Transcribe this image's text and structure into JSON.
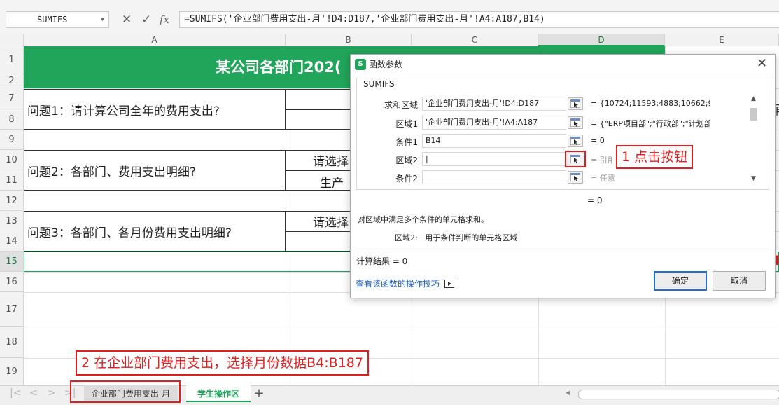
{
  "formula_bar": {
    "name_box": "SUMIFS",
    "cancel_glyph": "✕",
    "enter_glyph": "✓",
    "fx_label": "fx",
    "formula": "=SUMIFS('企业部门费用支出-月'!D4:D187,'企业部门费用支出-月'!A4:A187,B14)"
  },
  "columns": [
    "A",
    "B",
    "C",
    "D",
    "E"
  ],
  "rows": [
    "1",
    "2",
    "7",
    "8",
    "9",
    "10",
    "11",
    "12",
    "13",
    "14",
    "15",
    "16",
    "17",
    "18",
    "19"
  ],
  "sheet": {
    "title": "某公司各部门202(",
    "q1": "问题1：请计算公司全年的费用支出?",
    "q2": "问题2：各部门、费用支出明细?",
    "q2_b1": "请选择",
    "q2_b2": "生产",
    "q3": "问题3：各部门、各月份费用支出明细?",
    "q3_b1": "请选择",
    "edge_e7": "辅",
    "edge_e15": "4"
  },
  "tabs": {
    "sheet1": "企业部门费用支出-月",
    "sheet2": "学生操作区",
    "add": "+"
  },
  "annotations": {
    "step1": "1 点击按钮",
    "step2": "2 在企业部门费用支出，选择月份数据B4:B187"
  },
  "dialog": {
    "logo": "S",
    "title": "函数参数",
    "close": "✕",
    "function_name": "SUMIFS",
    "params": [
      {
        "label": "求和区域",
        "value": "'企业部门费用支出-月'!D4:D187",
        "result": "= {10724;11593;4883;10662;9343;46..."
      },
      {
        "label": "区域1",
        "value": "'企业部门费用支出-月'!A4:A187",
        "result": "= {\"ERP项目部\";\"行政部\";\"计划部\";\"生..."
      },
      {
        "label": "条件1",
        "value": "B14",
        "result": "= 0"
      },
      {
        "label": "区域2",
        "value": "|",
        "result": "= 引用"
      },
      {
        "label": "条件2",
        "value": "",
        "result": "= 任意"
      }
    ],
    "formula_result_line": "= 0",
    "description": "对区域中满足多个条件的单元格求和。",
    "param_desc_label": "区域2:",
    "param_desc_text": "用于条件判断的单元格区域",
    "calc_result": "计算结果 = 0",
    "help_link": "查看该函数的操作技巧",
    "ok": "确定",
    "cancel": "取消"
  },
  "colors": {
    "accent_green": "#21a55a",
    "annotation_red": "#e02020",
    "link_blue": "#1f5fbf"
  }
}
